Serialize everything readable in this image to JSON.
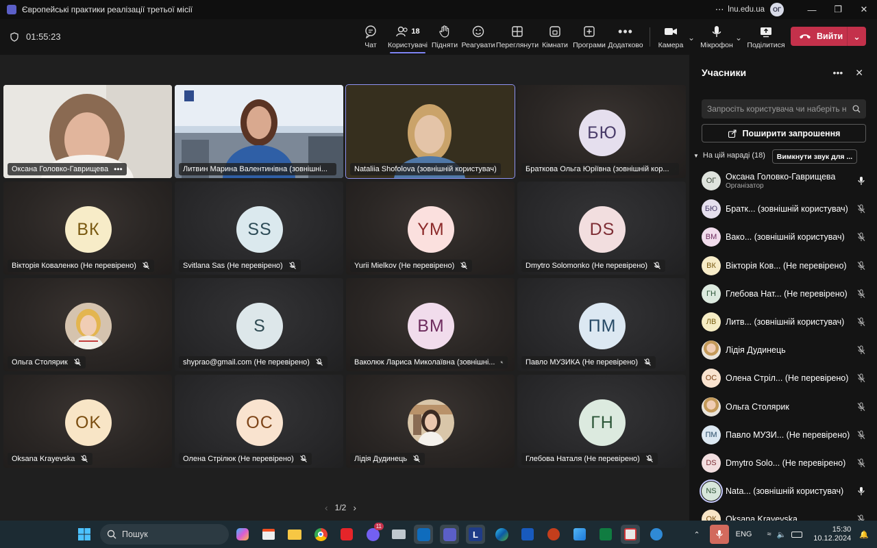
{
  "window": {
    "title": "Європейські практики реалізації третьої місії",
    "org": "lnu.edu.ua",
    "user_initials": "ОГ"
  },
  "toolbar": {
    "timer": "01:55:23",
    "chat": "Чат",
    "people": "Користувачі",
    "people_count": "18",
    "raise": "Підняти",
    "react": "Реагувати",
    "view": "Переглянути",
    "rooms": "Кімнати",
    "apps": "Програми",
    "more": "Додатково",
    "camera": "Камера",
    "mic": "Мікрофон",
    "share": "Поділитися",
    "leave": "Вийти"
  },
  "tiles": [
    {
      "name": "Оксана Головко-Гаврищева",
      "initials": "",
      "photo": "webcam-1",
      "muted": false,
      "more": true
    },
    {
      "name": "Литвин Марина Валентинівна (зовнішні...",
      "initials": "",
      "photo": "webcam-2",
      "muted": true
    },
    {
      "name": "Nataliia Shofolova (зовнішній користувач)",
      "initials": "",
      "photo": "webcam-3",
      "muted": false,
      "active": true
    },
    {
      "name": "Браткова Ольга Юріївна (зовнішній кор...",
      "initials": "БЮ",
      "muted": true,
      "bg": "#e5dfee",
      "fg": "#4a3d6a"
    },
    {
      "name": "Вікторія Коваленко (Не перевірено)",
      "initials": "ВК",
      "muted": true,
      "bg": "#f7ecc8",
      "fg": "#7a5a12"
    },
    {
      "name": "Svitlana Sas (Не перевірено)",
      "initials": "SS",
      "muted": true,
      "bg": "#dbe9ee",
      "fg": "#2e4c57"
    },
    {
      "name": "Yurii Mielkov (Не перевірено)",
      "initials": "YM",
      "muted": true,
      "bg": "#fbe0de",
      "fg": "#8c2a2a"
    },
    {
      "name": "Dmytro Solomonko (Не перевірено)",
      "initials": "DS",
      "muted": true,
      "bg": "#f2dedf",
      "fg": "#7e2e35"
    },
    {
      "name": "Ольга Столярик",
      "initials": "",
      "photo": "avatar-1",
      "muted": true
    },
    {
      "name": "shyprao@gmail.com (Не перевірено)",
      "initials": "S",
      "muted": true,
      "bg": "#dde7ea",
      "fg": "#2f4a52"
    },
    {
      "name": "Ваколюк Лариса Миколаївна (зовнішні...",
      "initials": "ВМ",
      "muted": true,
      "bg": "#f1dcec",
      "fg": "#6e2c5e"
    },
    {
      "name": "Павло МУЗИКА (Не перевірено)",
      "initials": "ПМ",
      "muted": true,
      "bg": "#dce8f2",
      "fg": "#274a66"
    },
    {
      "name": "Oksana Krayevska",
      "initials": "OK",
      "muted": true,
      "bg": "#f8e5c6",
      "fg": "#7a4d10"
    },
    {
      "name": "Олена Стрілюк (Не перевірено)",
      "initials": "ОС",
      "muted": true,
      "bg": "#f9e3cf",
      "fg": "#7d4418"
    },
    {
      "name": "Лідія Дудинець",
      "initials": "",
      "photo": "avatar-2",
      "muted": true
    },
    {
      "name": "Глебова Наталя (Не перевірено)",
      "initials": "ГН",
      "muted": true,
      "bg": "#dceadf",
      "fg": "#2c5638"
    }
  ],
  "pager": {
    "text": "1/2"
  },
  "panel": {
    "title": "Учасники",
    "search_placeholder": "Запросіть користувача чи наберіть н",
    "share_invite": "Поширити запрошення",
    "section": "На цій нараді (18)",
    "mute_all": "Вимкнути звук для ...",
    "participants": [
      {
        "initials": "ОГ",
        "name": "Оксана Головко-Гаврищева",
        "sub": "Організатор",
        "mic": "on",
        "bg": "#dfe3dd",
        "fg": "#3c4a3a"
      },
      {
        "initials": "БЮ",
        "name": "Братк... (зовнішній користувач)",
        "sub": "",
        "mic": "off",
        "bg": "#e5dfee",
        "fg": "#4a3d6a"
      },
      {
        "initials": "ВМ",
        "name": "Вако... (зовнішній користувач)",
        "sub": "",
        "mic": "off",
        "bg": "#f1dcec",
        "fg": "#6e2c5e"
      },
      {
        "initials": "ВК",
        "name": "Вікторія Ков... (Не перевірено)",
        "sub": "",
        "mic": "off",
        "bg": "#f7ecc8",
        "fg": "#7a5a12"
      },
      {
        "initials": "ГН",
        "name": "Глебова Нат... (Не перевірено)",
        "sub": "",
        "mic": "off",
        "bg": "#dceadf",
        "fg": "#2c5638"
      },
      {
        "initials": "ЛВ",
        "name": "Литв... (зовнішній користувач)",
        "sub": "",
        "mic": "off",
        "bg": "#f6edc4",
        "fg": "#7a6012"
      },
      {
        "initials": "",
        "name": "Лідія Дудинець",
        "sub": "",
        "mic": "off",
        "photo": true
      },
      {
        "initials": "ОС",
        "name": "Олена Стріл... (Не перевірено)",
        "sub": "",
        "mic": "off",
        "bg": "#f9e3cf",
        "fg": "#7d4418"
      },
      {
        "initials": "",
        "name": "Ольга Столярик",
        "sub": "",
        "mic": "off",
        "photo": true
      },
      {
        "initials": "ПМ",
        "name": "Павло МУЗИ... (Не перевірено)",
        "sub": "",
        "mic": "off",
        "bg": "#dce8f2",
        "fg": "#274a66"
      },
      {
        "initials": "DS",
        "name": "Dmytro Solo... (Не перевірено)",
        "sub": "",
        "mic": "off",
        "bg": "#f2dedf",
        "fg": "#7e2e35"
      },
      {
        "initials": "NS",
        "name": "Nata... (зовнішній користувач)",
        "sub": "",
        "mic": "on",
        "bg": "#d7e6db",
        "fg": "#2e5236",
        "selected": true
      },
      {
        "initials": "ОК",
        "name": "Oksana Krayevska",
        "sub": "",
        "mic": "off",
        "bg": "#f8e5c6",
        "fg": "#7a4d10"
      }
    ]
  },
  "taskbar": {
    "search": "Пошук",
    "lang": "ENG",
    "time": "15:30",
    "date": "10.12.2024",
    "chat_badge": "11"
  },
  "colors": {
    "accent": "#7f85f5",
    "leave": "#c4314b",
    "stage": "#1f1f1f",
    "panel": "#141414"
  }
}
